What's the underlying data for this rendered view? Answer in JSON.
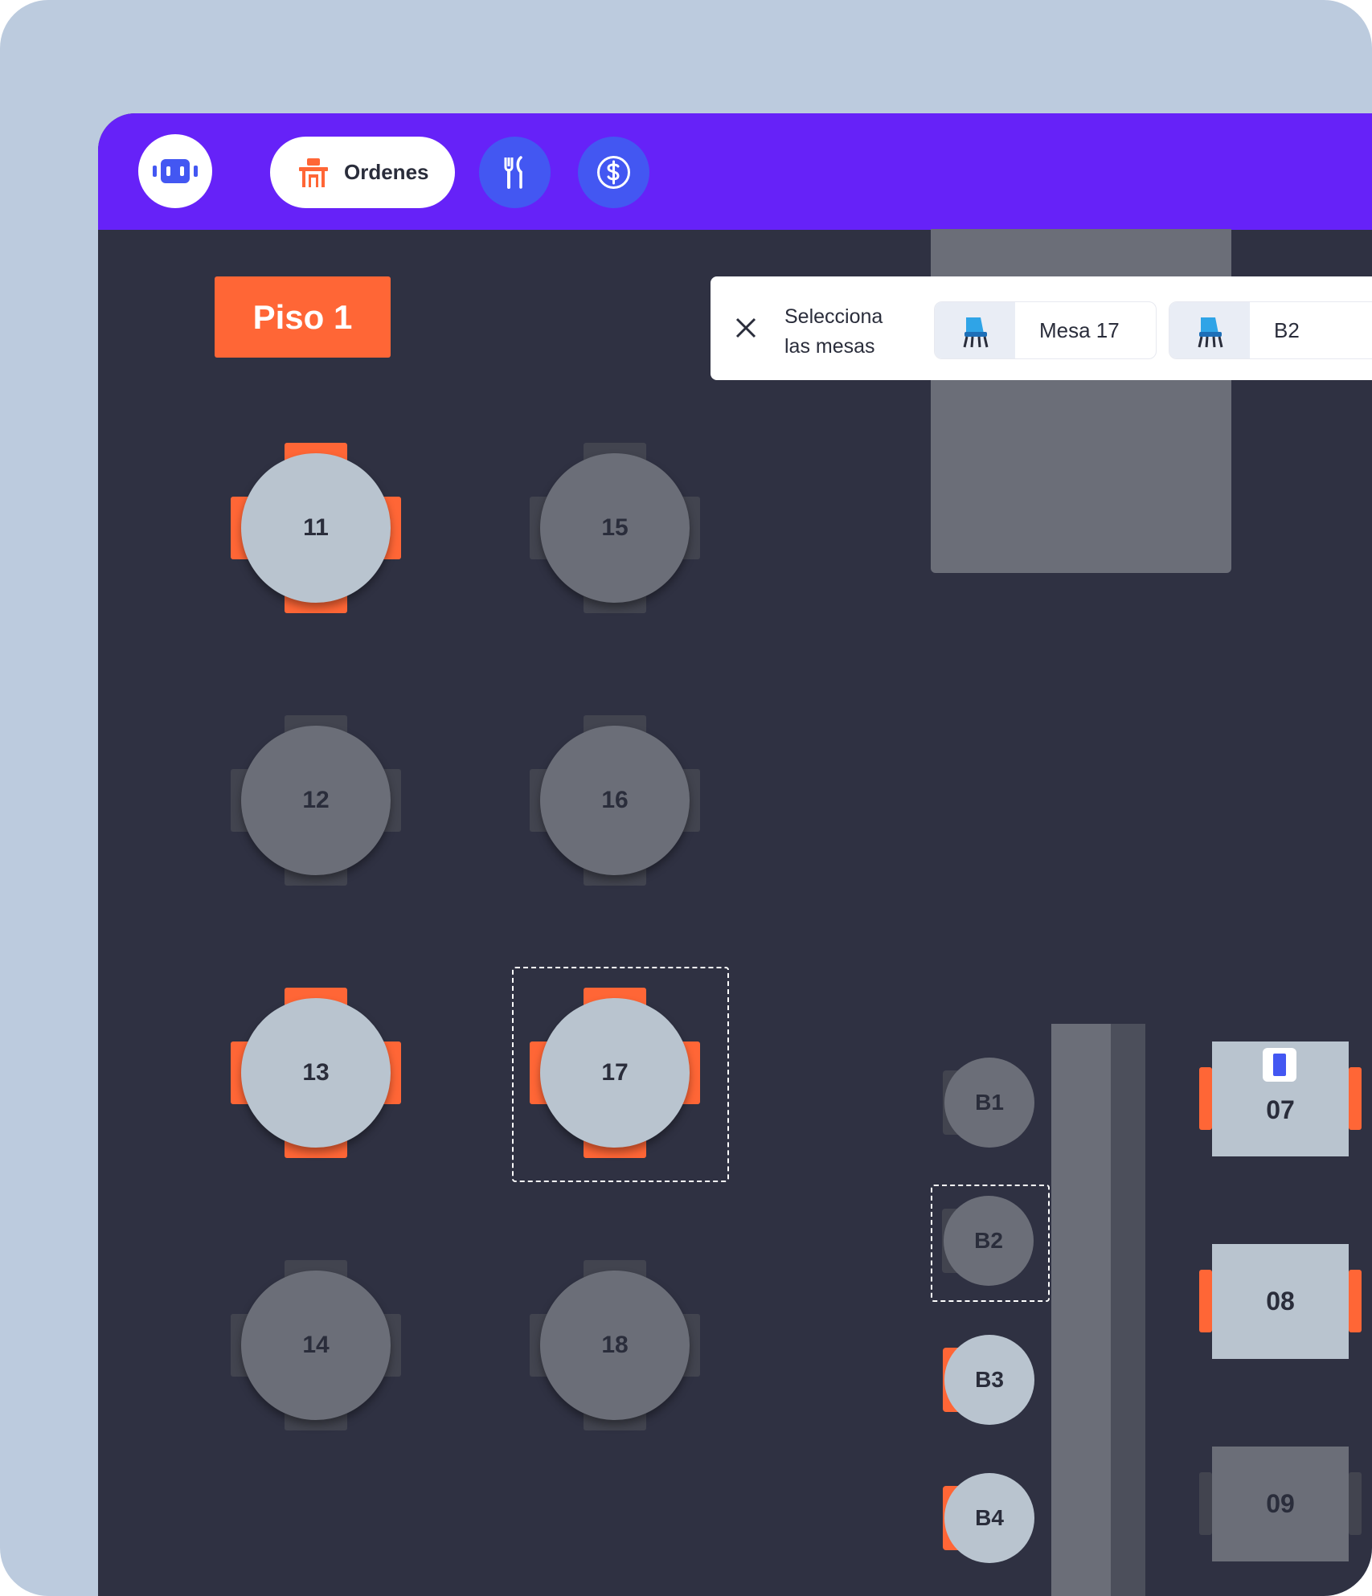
{
  "topbar": {
    "ordenes_label": "Ordenes",
    "logo_icon": "robot-logo-icon",
    "nav_icons": [
      "table-icon",
      "cutlery-icon",
      "dollar-icon"
    ]
  },
  "floor": {
    "label": "Piso 1"
  },
  "selection": {
    "title": "Selecciona las mesas",
    "chips": [
      {
        "label": "Mesa 17",
        "icon": "chair-icon"
      },
      {
        "label": "B2",
        "icon": "chair-icon"
      }
    ]
  },
  "tables": {
    "round": [
      {
        "label": "11",
        "status": "occupied"
      },
      {
        "label": "15",
        "status": "free"
      },
      {
        "label": "12",
        "status": "free"
      },
      {
        "label": "16",
        "status": "free"
      },
      {
        "label": "13",
        "status": "occupied"
      },
      {
        "label": "17",
        "status": "occupied",
        "selected": true
      },
      {
        "label": "14",
        "status": "free"
      },
      {
        "label": "18",
        "status": "free"
      }
    ],
    "bar_seats": [
      {
        "label": "B1",
        "status": "free"
      },
      {
        "label": "B2",
        "status": "free",
        "selected": true
      },
      {
        "label": "B3",
        "status": "occupied"
      },
      {
        "label": "B4",
        "status": "occupied"
      }
    ],
    "square": [
      {
        "label": "07",
        "status": "occupied",
        "has_phone": true
      },
      {
        "label": "08",
        "status": "occupied"
      },
      {
        "label": "09",
        "status": "free"
      }
    ]
  },
  "colors": {
    "topbar": "#6622f8",
    "accent_orange": "#ff6636",
    "floor_bg": "#2f3142",
    "button_blue": "#4357f2",
    "selected_table": "#b9c4cf",
    "free_table": "#6b6e78"
  }
}
